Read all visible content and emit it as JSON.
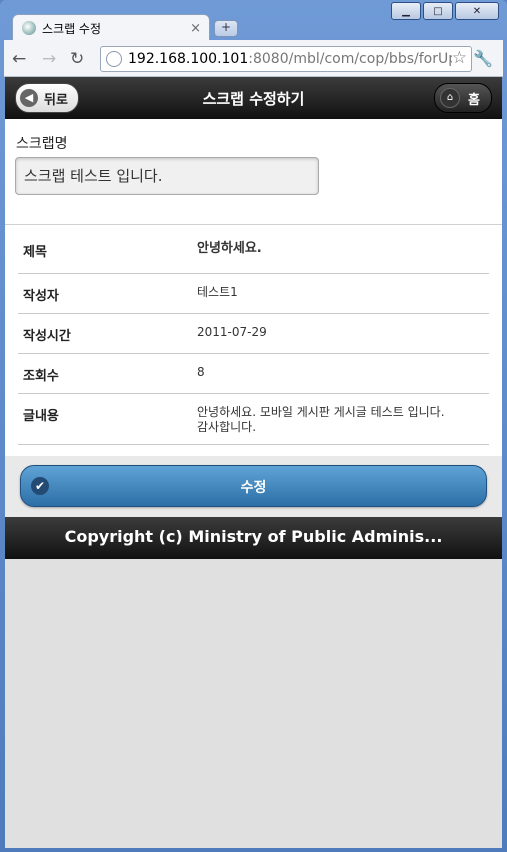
{
  "browser": {
    "tab_title": "스크랩 수정",
    "tab_close": "×",
    "new_tab": "+",
    "url_host": "192.168.100.101",
    "url_path": ":8080/mbl/com/cop/bbs/forUpd",
    "window_controls": {
      "minimize": "▁",
      "maximize": "□",
      "close": "✕"
    }
  },
  "header": {
    "back_label": "뒤로",
    "title": "스크랩 수정하기",
    "home_label": "홈"
  },
  "form": {
    "scrap_label": "스크랩명",
    "scrap_value": "스크랩 테스트 입니다."
  },
  "details": [
    {
      "label": "제목",
      "value": "안녕하세요."
    },
    {
      "label": "작성자",
      "value": "테스트1"
    },
    {
      "label": "작성시간",
      "value": "2011-07-29"
    },
    {
      "label": "조회수",
      "value": "8"
    },
    {
      "label": "글내용",
      "value": "안녕하세요. 모바일 게시판 게시글 테스트 입니다. 감사합니다."
    }
  ],
  "edit_button": "수정",
  "footer": "Copyright (c) Ministry of Public Adminis..."
}
